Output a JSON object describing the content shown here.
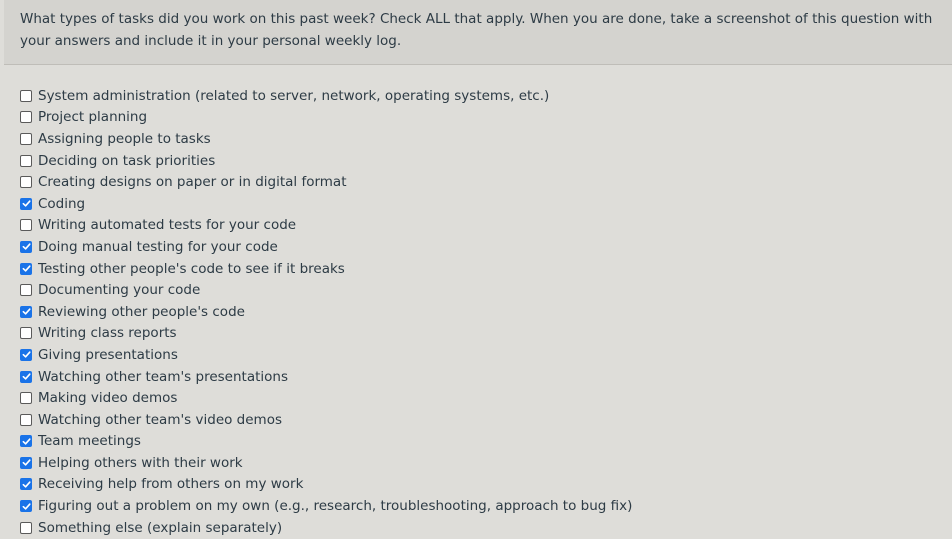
{
  "question": {
    "text": "What types of tasks did you work on this past week? Check ALL that apply. When you are done, take a screenshot of this question with your answers and include it in your personal weekly log."
  },
  "answers": [
    {
      "label": "System administration (related to server, network, operating systems, etc.)",
      "checked": false
    },
    {
      "label": "Project planning",
      "checked": false
    },
    {
      "label": "Assigning people to tasks",
      "checked": false
    },
    {
      "label": "Deciding on task priorities",
      "checked": false
    },
    {
      "label": "Creating designs on paper or in digital format",
      "checked": false
    },
    {
      "label": "Coding",
      "checked": true
    },
    {
      "label": "Writing automated tests for your code",
      "checked": false
    },
    {
      "label": "Doing manual testing for your code",
      "checked": true
    },
    {
      "label": "Testing other people's code to see if it breaks",
      "checked": true
    },
    {
      "label": "Documenting your code",
      "checked": false
    },
    {
      "label": "Reviewing other people's code",
      "checked": true
    },
    {
      "label": "Writing class reports",
      "checked": false
    },
    {
      "label": "Giving presentations",
      "checked": true
    },
    {
      "label": "Watching other team's presentations",
      "checked": true
    },
    {
      "label": "Making video demos",
      "checked": false
    },
    {
      "label": "Watching other team's video demos",
      "checked": false
    },
    {
      "label": "Team meetings",
      "checked": true
    },
    {
      "label": "Helping others with their work",
      "checked": true
    },
    {
      "label": "Receiving help from others on my work",
      "checked": true
    },
    {
      "label": "Figuring out a problem on my own (e.g., research, troubleshooting, approach to bug fix)",
      "checked": true
    },
    {
      "label": "Something else (explain separately)",
      "checked": false
    }
  ],
  "colors": {
    "checked": "#1a73e8",
    "background": "#deddd9",
    "header": "#d4d3cf"
  }
}
